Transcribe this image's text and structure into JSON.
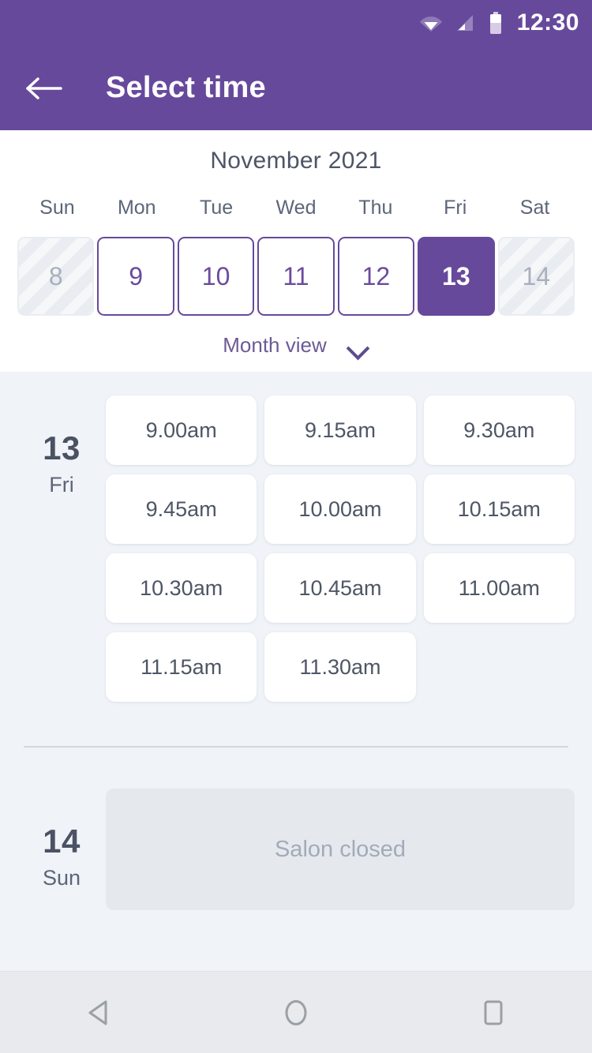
{
  "status_bar": {
    "time": "12:30",
    "icons": [
      "wifi-icon",
      "signal-icon",
      "battery-icon"
    ]
  },
  "app_bar": {
    "back_icon": "back-arrow-icon",
    "title": "Select time"
  },
  "calendar": {
    "month_label": "November 2021",
    "weekdays": [
      "Sun",
      "Mon",
      "Tue",
      "Wed",
      "Thu",
      "Fri",
      "Sat"
    ],
    "dates": [
      {
        "day": "8",
        "state": "disabled"
      },
      {
        "day": "9",
        "state": "available"
      },
      {
        "day": "10",
        "state": "available"
      },
      {
        "day": "11",
        "state": "available"
      },
      {
        "day": "12",
        "state": "available"
      },
      {
        "day": "13",
        "state": "selected"
      },
      {
        "day": "14",
        "state": "disabled"
      }
    ],
    "view_toggle_label": "Month view",
    "view_toggle_icon": "chevron-down-icon"
  },
  "schedule": [
    {
      "day_number": "13",
      "day_of_week": "Fri",
      "slots": [
        "9.00am",
        "9.15am",
        "9.30am",
        "9.45am",
        "10.00am",
        "10.15am",
        "10.30am",
        "10.45am",
        "11.00am",
        "11.15am",
        "11.30am"
      ]
    },
    {
      "day_number": "14",
      "day_of_week": "Sun",
      "closed_message": "Salon closed"
    }
  ],
  "nav_bar": {
    "back": "back-triangle-icon",
    "home": "home-circle-icon",
    "recents": "recents-square-icon"
  },
  "colors": {
    "brand_purple": "#67499c",
    "page_bg": "#f0f3f7",
    "card_white": "#ffffff",
    "text_slate": "#4e5665",
    "muted": "#a3abb8",
    "disabled_cell": "#e9edf2",
    "divider": "#d3d8df",
    "nav_bg": "#e8eaed"
  }
}
